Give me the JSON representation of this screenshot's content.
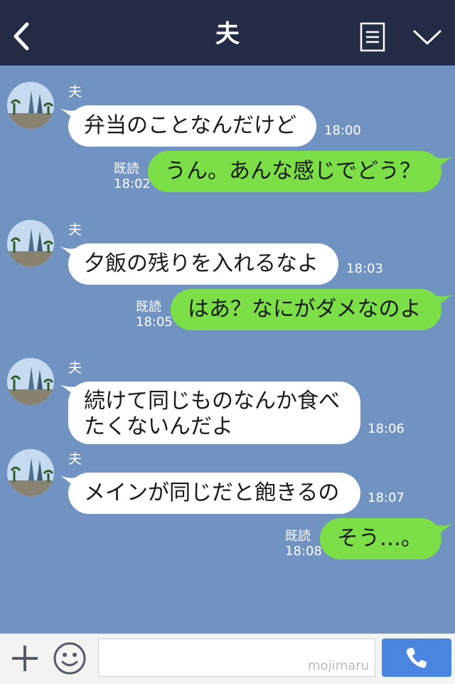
{
  "header": {
    "title": "夫"
  },
  "messages": [
    {
      "side": "left",
      "sender": "夫",
      "text": "弁当のことなんだけど",
      "time": "18:00"
    },
    {
      "side": "right",
      "read": "既読",
      "time": "18:02",
      "text": "うん。あんな感じでどう？"
    },
    {
      "side": "left",
      "sender": "夫",
      "text": "夕飯の残りを入れるなよ",
      "time": "18:03"
    },
    {
      "side": "right",
      "read": "既読",
      "time": "18:05",
      "text": "はあ？なにがダメなのよ"
    },
    {
      "side": "left",
      "sender": "夫",
      "text": "続けて同じものなんか食べたくないんだよ",
      "time": "18:06"
    },
    {
      "side": "left",
      "sender": "夫",
      "text": "メインが同じだと飽きるの",
      "time": "18:07"
    },
    {
      "side": "right",
      "read": "既読",
      "time": "18:08",
      "text": "そう…。"
    }
  ],
  "footer": {
    "watermark": "mojimaru"
  },
  "icons": [
    "back-chevron-icon",
    "notes-icon",
    "chevron-down-icon",
    "plus-icon",
    "smiley-icon",
    "phone-icon"
  ],
  "colors": {
    "header": "#232c44",
    "chat_bg": "#7093c2",
    "bubble_left": "#ffffff",
    "bubble_right": "#7ddf48",
    "call_button": "#4a86e0"
  }
}
